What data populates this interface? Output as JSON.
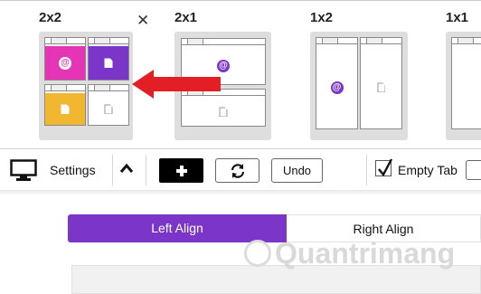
{
  "layouts": [
    {
      "label": "2x2"
    },
    {
      "label": "2x1"
    },
    {
      "label": "1x2"
    },
    {
      "label": "1x1"
    }
  ],
  "toolbar": {
    "settings_label": "Settings",
    "undo_label": "Undo",
    "empty_tab_label": "Empty Tab",
    "empty_tab_checked": true
  },
  "align": {
    "left_label": "Left Align",
    "right_label": "Right Align",
    "selected": "Left Align"
  },
  "colors": {
    "accent": "#7b35c9",
    "pink": "#e535b6",
    "yellow": "#f1b731",
    "arrow": "#e31e24"
  },
  "icons": [
    "close-icon",
    "at-sign-icon",
    "file-icon",
    "monitor-icon",
    "chevron-up-icon",
    "plus-icon",
    "refresh-icon",
    "check-icon"
  ],
  "watermark": "Quantrimang"
}
